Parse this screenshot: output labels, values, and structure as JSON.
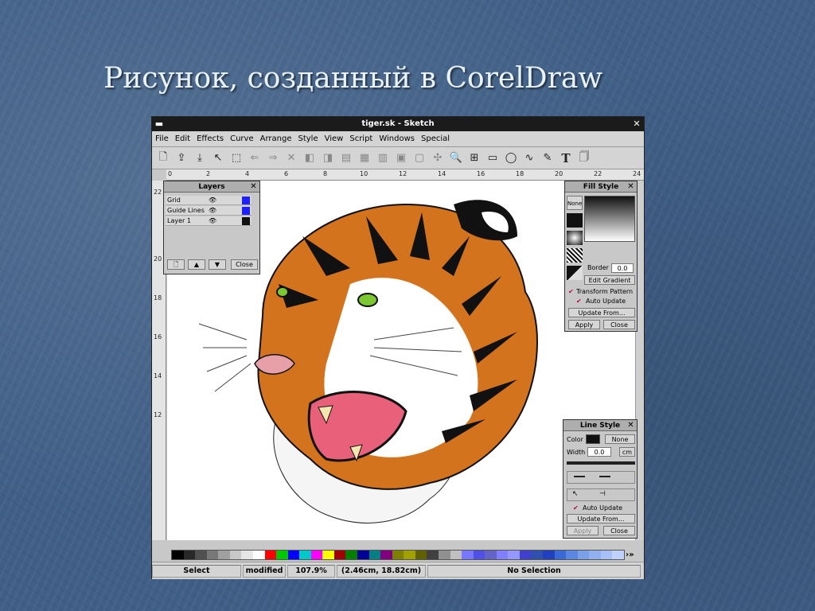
{
  "slide": {
    "title": "Рисунок, созданный в CorelDraw"
  },
  "window": {
    "title": "tiger.sk - Sketch",
    "menus": [
      "File",
      "Edit",
      "Effects",
      "Curve",
      "Arrange",
      "Style",
      "View",
      "Script",
      "Windows",
      "Special"
    ],
    "toolbar_icons": [
      "new-file-icon",
      "open-file-icon",
      "save-file-icon",
      "edit-tool-icon",
      "select-tool-icon",
      "undo-icon",
      "redo-icon",
      "delete-icon",
      "flip-h-icon",
      "flip-v-icon",
      "align-icon",
      "group-icon",
      "ungroup-icon",
      "front-icon",
      "back-icon",
      "snap-icon",
      "zoom-icon",
      "grid-icon",
      "rectangle-icon",
      "ellipse-icon",
      "bezier-icon",
      "freehand-icon",
      "text-icon",
      "page-icon"
    ],
    "text_tool_glyph": "T",
    "ruler_h_ticks": [
      "0",
      "2",
      "4",
      "6",
      "8",
      "10",
      "12",
      "14",
      "16",
      "18",
      "20",
      "22",
      "24"
    ],
    "ruler_v_ticks": [
      "22",
      "20",
      "18",
      "16",
      "14",
      "12"
    ]
  },
  "layers_panel": {
    "title": "Layers",
    "rows": [
      {
        "name": "Grid",
        "color": "#1e1eff"
      },
      {
        "name": "Guide Lines",
        "color": "#1e1eff"
      },
      {
        "name": "Layer 1",
        "color": "#111111"
      }
    ],
    "close_label": "Close"
  },
  "fill_panel": {
    "title": "Fill Style",
    "none_label": "None",
    "border_label": "Border",
    "border_value": "0.0",
    "edit_gradient_label": "Edit Gradient",
    "transform_label": "Transform Pattern",
    "auto_update_label": "Auto Update",
    "update_from_label": "Update From...",
    "apply_label": "Apply",
    "close_label": "Close"
  },
  "line_panel": {
    "title": "Line Style",
    "color_label": "Color",
    "none_label": "None",
    "width_label": "Width",
    "width_value": "0.0",
    "unit": "cm",
    "auto_update_label": "Auto Update",
    "update_from_label": "Update From...",
    "apply_label": "Apply",
    "close_label": "Close"
  },
  "palette_colors": [
    "#000000",
    "#282828",
    "#505050",
    "#787878",
    "#a0a0a0",
    "#c8c8c8",
    "#e6e6e6",
    "#ffffff",
    "#ff0000",
    "#00c800",
    "#0000ff",
    "#00c8c8",
    "#ff00ff",
    "#ffff00",
    "#a00000",
    "#008000",
    "#000096",
    "#008080",
    "#800080",
    "#808000",
    "#a0a000",
    "#606000",
    "#404040",
    "#909090",
    "#c0c0c0",
    "#7878ff",
    "#5050e6",
    "#6464c8",
    "#8080ff",
    "#9696ff",
    "#4040d0",
    "#3050b0",
    "#2040c0",
    "#3a6ad8",
    "#5a88e0",
    "#7aa0e8",
    "#90b0f0",
    "#a8c0f8",
    "#c0d0ff"
  ],
  "palette_scroll": "›»",
  "status": {
    "mode": "Select",
    "state": "modified",
    "zoom": "107.9%",
    "position": "(2.46cm, 18.82cm)",
    "selection": "No Selection"
  },
  "colors": {
    "slide_bg": "#3f5f86",
    "title_color": "#e9f3ff",
    "tiger_orange": "#d4731e",
    "tiger_eye": "#7cc832",
    "mouth_pink": "#e8607a"
  }
}
